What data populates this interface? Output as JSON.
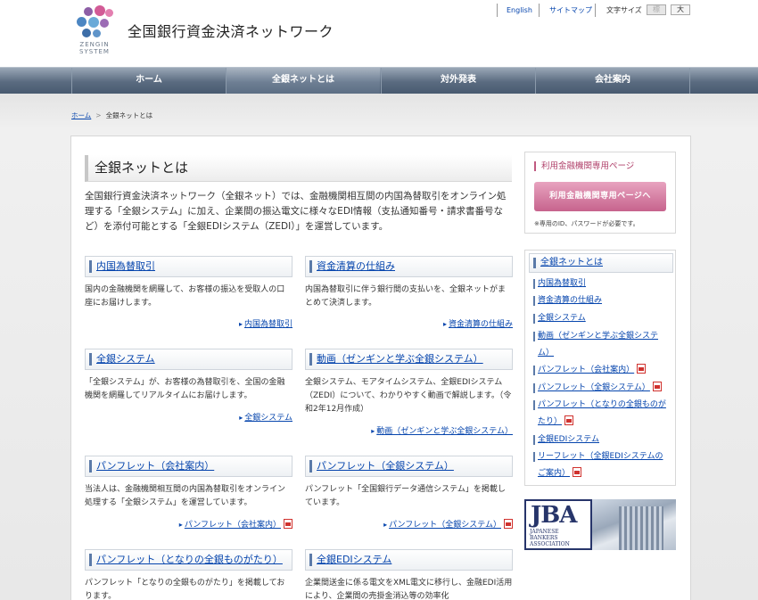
{
  "header": {
    "logo_text_line1": "ZENGIN",
    "logo_text_line2": "SYSTEM",
    "site_title": "全国銀行資金決済ネットワーク",
    "util_links": [
      {
        "label": "English"
      },
      {
        "label": "サイトマップ"
      }
    ],
    "font_size_label": "文字サイズ",
    "font_size_buttons": [
      "標",
      "大"
    ]
  },
  "nav": {
    "items": [
      {
        "label": "ホーム"
      },
      {
        "label": "全銀ネットとは",
        "active": true
      },
      {
        "label": "対外発表"
      },
      {
        "label": "会社案内"
      }
    ]
  },
  "breadcrumb": {
    "home": "ホーム",
    "current": "全銀ネットとは"
  },
  "main": {
    "title": "全銀ネットとは",
    "intro": "全国銀行資金決済ネットワーク（全銀ネット）では、金融機関相互間の内国為替取引をオンライン処理する「全銀システム」に加え、企業間の振込電文に様々なEDI情報（支払通知番号・請求書番号など）を添付可能とする「全銀EDIシステム（ZEDI）」を運営しています。",
    "cards": [
      {
        "title": "内国為替取引",
        "desc": "国内の金融機関を網羅して、お客様の振込を受取人の口座にお届けします。",
        "link": "内国為替取引",
        "pdf": false
      },
      {
        "title": "資金清算の仕組み",
        "desc": "内国為替取引に伴う銀行間の支払いを、全銀ネットがまとめて決済します。",
        "link": "資金清算の仕組み",
        "pdf": false
      },
      {
        "title": "全銀システム",
        "desc": "「全銀システム」が、お客様の為替取引を、全国の金融機関を網羅してリアルタイムにお届けします。",
        "link": "全銀システム",
        "pdf": false
      },
      {
        "title": "動画（ゼンギンと学ぶ全銀システム）",
        "desc": "全銀システム、モアタイムシステム、全銀EDIシステム（ZEDI）について、わかりやすく動画で解説します。（令和2年12月作成）",
        "link": "動画（ゼンギンと学ぶ全銀システム）",
        "pdf": false
      },
      {
        "title": "パンフレット（会社案内）",
        "desc": "当法人は、金融機関相互間の内国為替取引をオンライン処理する「全銀システム」を運営しています。",
        "link": "パンフレット（会社案内）",
        "pdf": true
      },
      {
        "title": "パンフレット（全銀システム）",
        "desc": "パンフレット「全国銀行データ通信システム」を掲載しています。",
        "link": "パンフレット（全銀システム）",
        "pdf": true
      },
      {
        "title": "パンフレット（となりの全銀ものがたり）",
        "desc": "パンフレット「となりの全銀ものがたり」を掲載しております。",
        "link": "",
        "pdf": false
      },
      {
        "title": "全銀EDIシステム",
        "desc": "企業間送金に係る電文をXML電文に移行し、金融EDI活用により、企業間の売掛金消込等の効率化",
        "link": "",
        "pdf": false
      }
    ]
  },
  "sidebar": {
    "member_title": "利用金融機関専用ページ",
    "member_button": "利用金融機関専用ページへ",
    "member_note": "※専用のID、パスワードが必要です。",
    "nav_title": "全銀ネットとは",
    "nav_items": [
      {
        "label": "内国為替取引",
        "pdf": false
      },
      {
        "label": "資金清算の仕組み",
        "pdf": false
      },
      {
        "label": "全銀システム",
        "pdf": false
      },
      {
        "label": "動画（ゼンギンと学ぶ全銀システム）",
        "pdf": false
      },
      {
        "label": "パンフレット（会社案内）",
        "pdf": true
      },
      {
        "label": "パンフレット（全銀システム）",
        "pdf": true
      },
      {
        "label": "パンフレット（となりの全銀ものがたり）",
        "pdf": true
      },
      {
        "label": "全銀EDIシステム",
        "pdf": false
      },
      {
        "label": "リーフレット（全銀EDIシステムのご案内）",
        "pdf": true
      }
    ],
    "banner": {
      "letters": "JBA",
      "line1": "JAPANESE",
      "line2": "BANKERS",
      "line3": "ASSOCIATION"
    }
  },
  "colors": {
    "link": "#0645ad",
    "nav_bg": "#5a6b80",
    "member_button": "#c7638d",
    "jba_navy": "#27356a"
  }
}
